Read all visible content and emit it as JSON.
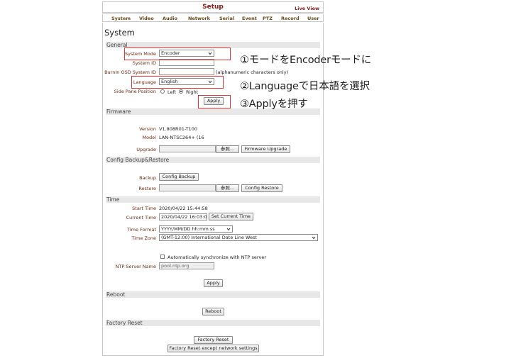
{
  "header": {
    "title": "Setup",
    "live_view": "Live View"
  },
  "nav": [
    "System",
    "Video",
    "Audio",
    "Network",
    "Serial",
    "Event",
    "PTZ",
    "Record",
    "User"
  ],
  "page_title": "System",
  "general": {
    "section": "General",
    "system_mode_label": "System Mode",
    "system_mode_value": "Encoder",
    "system_id_label": "System ID",
    "system_id_value": "",
    "burnin_label": "BurnIn OSD System ID",
    "burnin_value": "",
    "burnin_hint": "(alphanumeric characters only)",
    "language_label": "Language",
    "language_value": "English",
    "side_pane_label": "Side Pane Position",
    "side_left": "Left",
    "side_right": "Right",
    "side_selected": "Right",
    "apply": "Apply"
  },
  "firmware": {
    "section": "Firmware",
    "version_label": "Version",
    "version_value": "V1.808R01-T100",
    "model_label": "Model",
    "model_value": "LAN-NTSC264+ (16",
    "upgrade_label": "Upgrade",
    "browse": "参照...",
    "upgrade_button": "Firmware Upgrade"
  },
  "backup": {
    "section": "Config Backup&Restore",
    "backup_label": "Backup",
    "backup_button": "Config Backup",
    "restore_label": "Restore",
    "browse": "参照...",
    "restore_button": "Config Restore"
  },
  "time": {
    "section": "Time",
    "start_label": "Start Time",
    "start_value": "2020/04/22 15:44:58",
    "current_label": "Current Time",
    "current_value": "2020/04/22 16:03:00",
    "set_current": "Set Current Time",
    "format_label": "Time Format",
    "format_value": "YYYY/MM/DD hh:mm:ss",
    "zone_label": "Time Zone",
    "zone_value": "(GMT-12:00) International Date Line West",
    "ntp_sync_label": "Automatically synchronize with NTP server",
    "ntp_server_label": "NTP Server Name",
    "ntp_server_value": "pool.ntp.org",
    "apply": "Apply"
  },
  "reboot": {
    "section": "Reboot",
    "button": "Reboot"
  },
  "factory": {
    "section": "Factory Reset",
    "button": "Factory Reset",
    "button_except": "Factory Reset except network settings"
  },
  "annotations": {
    "step1": "①モードをEncoderモードに",
    "step2": "②Languageで日本語を選択",
    "step3": "③Applyを押す"
  },
  "colors": {
    "label": "#6b2a14",
    "highlight": "#e03030",
    "header": "#8a1a1a"
  }
}
